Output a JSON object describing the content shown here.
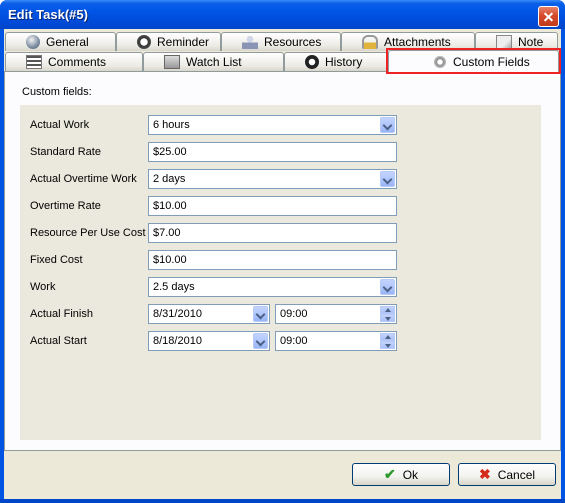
{
  "window": {
    "title": "Edit Task(#5)"
  },
  "tabs": {
    "row1": [
      {
        "label": "General",
        "icon": "globe-icon"
      },
      {
        "label": "Reminder",
        "icon": "alarm-clock-icon"
      },
      {
        "label": "Resources",
        "icon": "people-icon"
      },
      {
        "label": "Attachments",
        "icon": "padlock-icon"
      },
      {
        "label": "Note",
        "icon": "note-icon"
      }
    ],
    "row2": [
      {
        "label": "Comments",
        "icon": "comments-icon"
      },
      {
        "label": "Watch List",
        "icon": "watch-list-icon"
      },
      {
        "label": "History",
        "icon": "history-icon"
      },
      {
        "label": "Custom Fields",
        "icon": "gear-icon",
        "active": true
      }
    ]
  },
  "custom_fields": {
    "section_label": "Custom fields:",
    "fields": [
      {
        "label": "Actual Work",
        "value": "6 hours",
        "type": "dropdown"
      },
      {
        "label": "Standard Rate",
        "value": "$25.00",
        "type": "text"
      },
      {
        "label": "Actual Overtime Work",
        "value": "2 days",
        "type": "dropdown"
      },
      {
        "label": "Overtime Rate",
        "value": "$10.00",
        "type": "text"
      },
      {
        "label": "Resource Per Use Cost",
        "value": "$7.00",
        "type": "text"
      },
      {
        "label": "Fixed Cost",
        "value": "$10.00",
        "type": "text"
      },
      {
        "label": "Work",
        "value": "2.5 days",
        "type": "dropdown"
      },
      {
        "label": "Actual Finish",
        "date": "8/31/2010",
        "time": "09:00",
        "type": "datetime"
      },
      {
        "label": "Actual Start",
        "date": "8/18/2010",
        "time": "09:00",
        "type": "datetime"
      }
    ]
  },
  "buttons": {
    "ok_label": "Ok",
    "cancel_label": "Cancel"
  },
  "colors": {
    "titlebar": "#0054e3",
    "dialog_bg": "#ece9d8",
    "highlight": "#ee2222",
    "input_border": "#7f9db9"
  }
}
